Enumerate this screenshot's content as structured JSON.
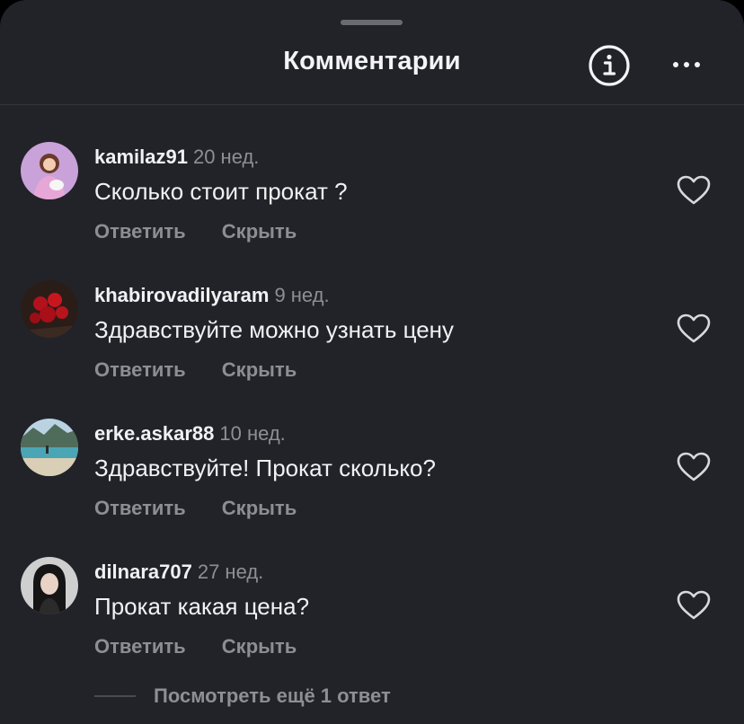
{
  "header": {
    "title": "Комментарии"
  },
  "comments": [
    {
      "username": "kamilaz91",
      "time": "20 нед.",
      "text": "Сколько стоит прокат ?",
      "reply_label": "Ответить",
      "hide_label": "Скрыть"
    },
    {
      "username": "khabirovadilyaram",
      "time": "9 нед.",
      "text": "Здравствуйте можно узнать цену",
      "reply_label": "Ответить",
      "hide_label": "Скрыть"
    },
    {
      "username": "erke.askar88",
      "time": "10 нед.",
      "text": "Здравствуйте! Прокат сколько?",
      "reply_label": "Ответить",
      "hide_label": "Скрыть"
    },
    {
      "username": "dilnara707",
      "time": "27 нед.",
      "text": "Прокат какая цена?",
      "reply_label": "Ответить",
      "hide_label": "Скрыть"
    }
  ],
  "more_replies": "Посмотреть ещё 1 ответ",
  "icons": {
    "info": "info-icon",
    "more": "more-horizontal-icon",
    "like": "heart-outline-icon"
  },
  "colors": {
    "background": "#222329",
    "text_primary": "#f1f1f3",
    "text_secondary": "#8e8f95"
  }
}
